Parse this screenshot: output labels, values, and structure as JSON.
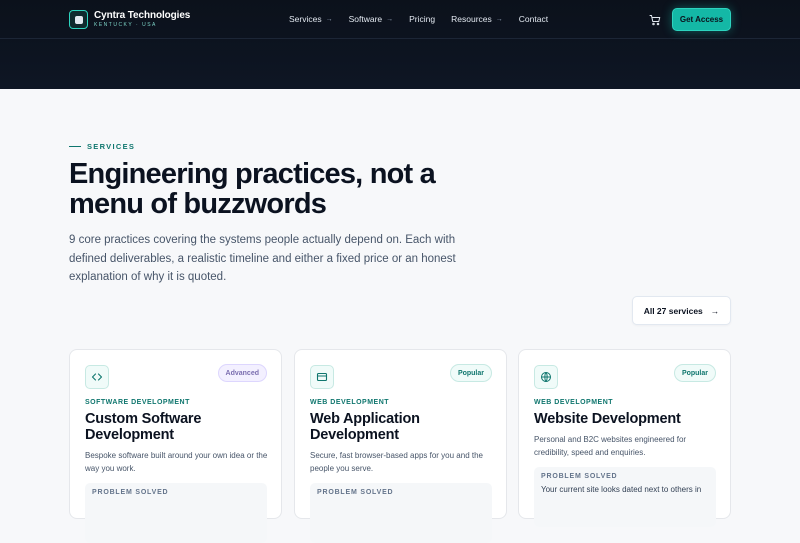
{
  "brand": {
    "name": "Cyntra Technologies",
    "sub": "KENTUCKY · USA"
  },
  "nav": {
    "items": [
      {
        "label": "Services",
        "arrow": "→"
      },
      {
        "label": "Software",
        "arrow": "→"
      },
      {
        "label": "Pricing",
        "arrow": ""
      },
      {
        "label": "Resources",
        "arrow": "→"
      },
      {
        "label": "Contact",
        "arrow": ""
      }
    ],
    "cta": "Get Access"
  },
  "hero": {
    "eyebrow": "SERVICES",
    "headline": "Engineering practices, not a menu of buzzwords",
    "lede": "9 core practices covering the systems people actually depend on. Each with defined deliverables, a realistic timeline and either a fixed price or an honest explanation of why it is quoted.",
    "all_button": "All 27 services",
    "all_arrow": "→"
  },
  "cards": [
    {
      "icon": "code-icon",
      "badge": "Advanced",
      "category": "SOFTWARE DEVELOPMENT",
      "title": "Custom Software Development",
      "desc": "Bespoke software built around your own idea or the way you work.",
      "problem_label": "PROBLEM SOLVED",
      "problem_text": ""
    },
    {
      "icon": "browser-window-icon",
      "badge": "Popular",
      "category": "WEB DEVELOPMENT",
      "title": "Web Application Development",
      "desc": "Secure, fast browser-based apps for you and the people you serve.",
      "problem_label": "PROBLEM SOLVED",
      "problem_text": ""
    },
    {
      "icon": "globe-icon",
      "badge": "Popular",
      "category": "WEB DEVELOPMENT",
      "title": "Website Development",
      "desc": "Personal and B2C websites engineered for credibility, speed and enquiries.",
      "problem_label": "PROBLEM SOLVED",
      "problem_text": "Your current site looks dated next to others in"
    }
  ]
}
